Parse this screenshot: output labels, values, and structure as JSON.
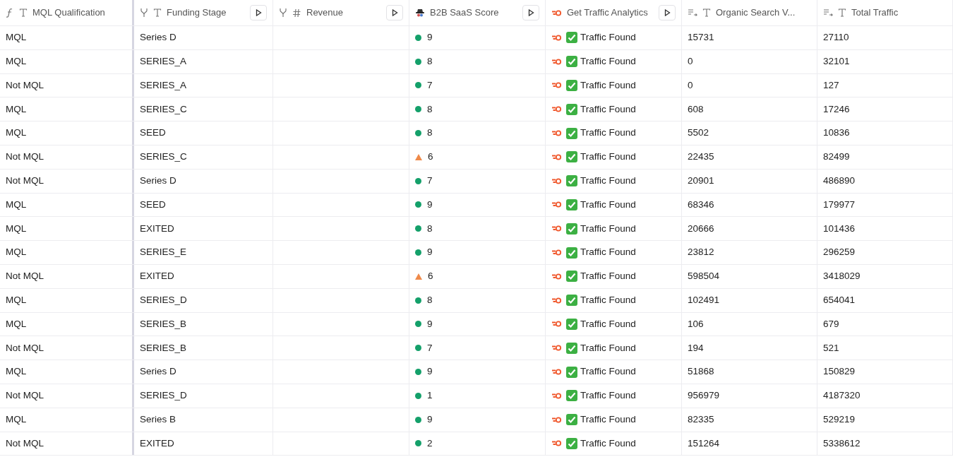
{
  "table": {
    "columns": [
      {
        "label": "MQL Qualification",
        "kind": "formula",
        "run_button": false
      },
      {
        "label": "Funding Stage",
        "kind": "merge_text",
        "run_button": true
      },
      {
        "label": "Revenue",
        "kind": "merge_number",
        "run_button": true
      },
      {
        "label": "B2B SaaS Score",
        "kind": "spy",
        "run_button": true
      },
      {
        "label": "Get Traffic Analytics",
        "kind": "flame",
        "run_button": true
      },
      {
        "label": "Organic Search V...",
        "kind": "list_text",
        "run_button": false
      },
      {
        "label": "Total Traffic",
        "kind": "list_text",
        "run_button": false
      }
    ],
    "rows": [
      {
        "mql": "MQL",
        "funding": "Series D",
        "score": "9",
        "kind": "dot",
        "traffic": "Traffic Found",
        "organic": "15731",
        "total": "27110"
      },
      {
        "mql": "MQL",
        "funding": "SERIES_A",
        "score": "8",
        "kind": "dot",
        "traffic": "Traffic Found",
        "organic": "0",
        "total": "32101"
      },
      {
        "mql": "Not MQL",
        "funding": "SERIES_A",
        "score": "7",
        "kind": "dot",
        "traffic": "Traffic Found",
        "organic": "0",
        "total": "127"
      },
      {
        "mql": "MQL",
        "funding": "SERIES_C",
        "score": "8",
        "kind": "dot",
        "traffic": "Traffic Found",
        "organic": "608",
        "total": "17246"
      },
      {
        "mql": "MQL",
        "funding": "SEED",
        "score": "8",
        "kind": "dot",
        "traffic": "Traffic Found",
        "organic": "5502",
        "total": "10836"
      },
      {
        "mql": "Not MQL",
        "funding": "SERIES_C",
        "score": "6",
        "kind": "triangle",
        "traffic": "Traffic Found",
        "organic": "22435",
        "total": "82499"
      },
      {
        "mql": "Not MQL",
        "funding": "Series D",
        "score": "7",
        "kind": "dot",
        "traffic": "Traffic Found",
        "organic": "20901",
        "total": "486890"
      },
      {
        "mql": "MQL",
        "funding": "SEED",
        "score": "9",
        "kind": "dot",
        "traffic": "Traffic Found",
        "organic": "68346",
        "total": "179977"
      },
      {
        "mql": "MQL",
        "funding": "EXITED",
        "score": "8",
        "kind": "dot",
        "traffic": "Traffic Found",
        "organic": "20666",
        "total": "101436"
      },
      {
        "mql": "MQL",
        "funding": "SERIES_E",
        "score": "9",
        "kind": "dot",
        "traffic": "Traffic Found",
        "organic": "23812",
        "total": "296259"
      },
      {
        "mql": "Not MQL",
        "funding": "EXITED",
        "score": "6",
        "kind": "triangle",
        "traffic": "Traffic Found",
        "organic": "598504",
        "total": "3418029"
      },
      {
        "mql": "MQL",
        "funding": "SERIES_D",
        "score": "8",
        "kind": "dot",
        "traffic": "Traffic Found",
        "organic": "102491",
        "total": "654041"
      },
      {
        "mql": "MQL",
        "funding": "SERIES_B",
        "score": "9",
        "kind": "dot",
        "traffic": "Traffic Found",
        "organic": "106",
        "total": "679"
      },
      {
        "mql": "Not MQL",
        "funding": "SERIES_B",
        "score": "7",
        "kind": "dot",
        "traffic": "Traffic Found",
        "organic": "194",
        "total": "521"
      },
      {
        "mql": "MQL",
        "funding": "Series D",
        "score": "9",
        "kind": "dot",
        "traffic": "Traffic Found",
        "organic": "51868",
        "total": "150829"
      },
      {
        "mql": "Not MQL",
        "funding": "SERIES_D",
        "score": "1",
        "kind": "dot",
        "traffic": "Traffic Found",
        "organic": "956979",
        "total": "4187320"
      },
      {
        "mql": "MQL",
        "funding": "Series B",
        "score": "9",
        "kind": "dot",
        "traffic": "Traffic Found",
        "organic": "82335",
        "total": "529219"
      },
      {
        "mql": "Not MQL",
        "funding": "EXITED",
        "score": "2",
        "kind": "dot",
        "traffic": "Traffic Found",
        "organic": "151264",
        "total": "5338612"
      }
    ]
  }
}
